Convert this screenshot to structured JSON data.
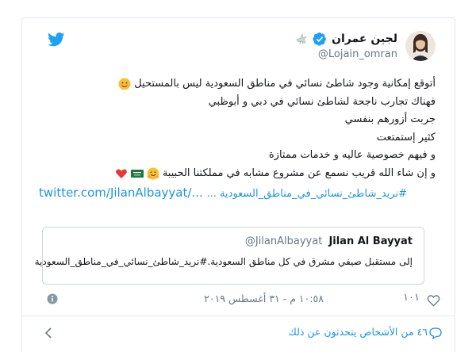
{
  "tweet": {
    "author": {
      "display_name": "لجين عمران",
      "handle": "@Lojain_omran"
    },
    "lines": [
      "أتوقع إمكانية وجود شاطئ نسائي في مناطق السعودية ليس بالمستحيل",
      "فهناك تجارب ناجحة لشاطئ نسائي في دبي و أبوظبي",
      "جربت أزورهم بنفسي",
      "كثير إستمتعت",
      "و فيهم خصوصية عاليه و خدمات ممتازة",
      "و إن شاء الله قريب نسمع عن مشروع مشابه في مملكتنا الحبيبة"
    ],
    "link_text": "twitter.com/JilanAlbayyat/...",
    "hashtag_text": "#نريد_شاطئ_نسائي_في_مناطق_السعودية ...",
    "quote": {
      "name": "Jilan Al Bayyat",
      "handle": "@JilanAlbayyat",
      "text": "إلى مستقبل صيفي مشرق في كل مناطق السعودية.#نريد_شاطئ_نسائي_في_مناطق_السعودية"
    },
    "likes": "١٠١",
    "timestamp": "١٠:٥٨ م - ٣١ أغسطس ٢٠١٩",
    "people_talking": "٤٦ من الأشخاص يتحدثون عن ذلك"
  },
  "icons": {
    "bird": "twitter-bird-icon",
    "verified": "verified-badge-icon",
    "dove": "dove-icon",
    "info": "info-icon",
    "heart": "heart-icon",
    "bubble": "comment-bubble-icon",
    "chevron": "chevron-left-icon"
  },
  "colors": {
    "twitter_blue": "#1da1f2",
    "link": "#1b95e0",
    "muted": "#657786",
    "heart_red": "#e0245e"
  }
}
